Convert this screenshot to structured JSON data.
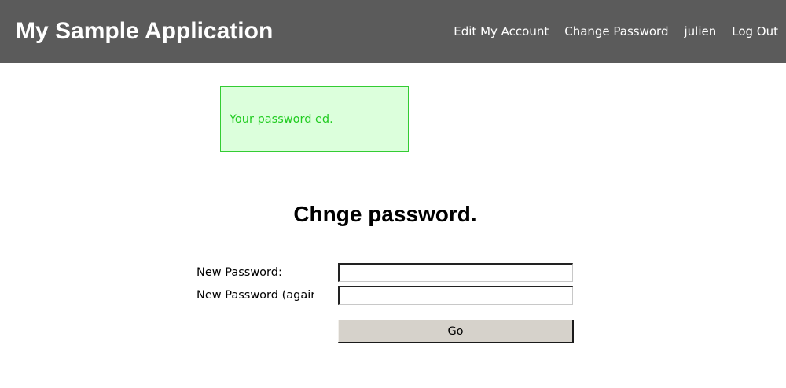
{
  "header": {
    "app_title": "My Sample Application",
    "background_color": "#5b5b5b",
    "nav": {
      "edit_account": "Edit My Account",
      "change_password": "Change Password",
      "username": "julien",
      "log_out": "Log Out"
    }
  },
  "flash": {
    "message": "Your password ed.",
    "background_color": "#dcffdc",
    "text_color": "#22cc22"
  },
  "main": {
    "title": "Chnge password.",
    "form": {
      "new_password_label": "New Password:",
      "new_password_value": "",
      "new_password_again_label": "New Password (again):",
      "new_password_again_value": "",
      "submit_label": "Go"
    }
  }
}
